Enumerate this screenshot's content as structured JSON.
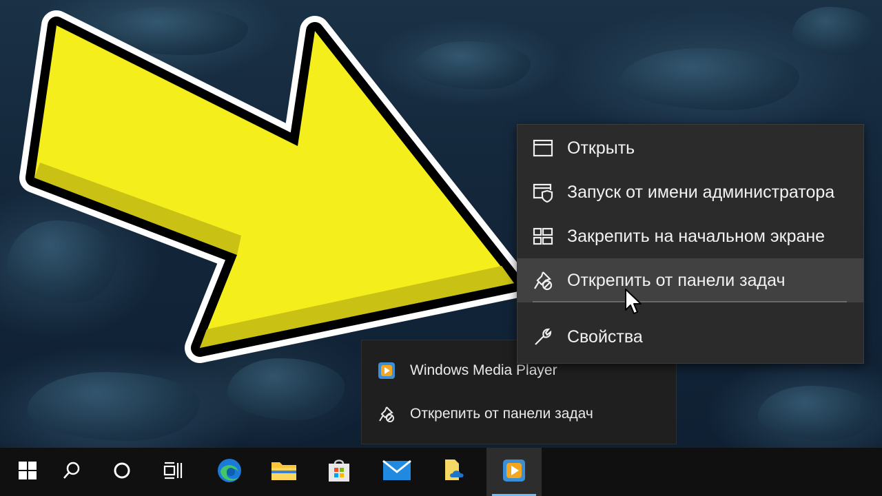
{
  "context_menu": {
    "items": [
      {
        "label": "Открыть",
        "icon": "window-icon"
      },
      {
        "label": "Запуск от имени администратора",
        "icon": "shield-window-icon"
      },
      {
        "label": "Закрепить на начальном экране",
        "icon": "tiles-icon"
      },
      {
        "label": "Открепить от панели задач",
        "icon": "unpin-icon",
        "highlighted": true
      },
      {
        "label": "Свойства",
        "icon": "wrench-icon"
      }
    ]
  },
  "jump_list": {
    "items": [
      {
        "label": "Windows Media Player",
        "icon": "media-player-icon"
      },
      {
        "label": "Открепить от панели задач",
        "icon": "unpin-icon"
      }
    ]
  },
  "taskbar": {
    "buttons": [
      {
        "name": "start",
        "icon": "windows-logo-icon"
      },
      {
        "name": "search",
        "icon": "search-icon"
      },
      {
        "name": "cortana",
        "icon": "cortana-circle-icon"
      },
      {
        "name": "task-view",
        "icon": "task-view-icon"
      },
      {
        "name": "edge",
        "icon": "edge-icon"
      },
      {
        "name": "file-explorer",
        "icon": "folder-icon"
      },
      {
        "name": "store",
        "icon": "store-bag-icon"
      },
      {
        "name": "mail",
        "icon": "mail-icon"
      },
      {
        "name": "onedrive-folder",
        "icon": "onedrive-file-icon"
      },
      {
        "name": "media-player",
        "icon": "media-player-icon",
        "active": true
      }
    ]
  },
  "colors": {
    "arrow_fill": "#f5ee1d",
    "arrow_outline": "#000000",
    "menu_bg": "#2b2b2b",
    "menu_highlight": "#414141",
    "taskbar_bg": "#101010",
    "accent": "#76b9ed"
  }
}
